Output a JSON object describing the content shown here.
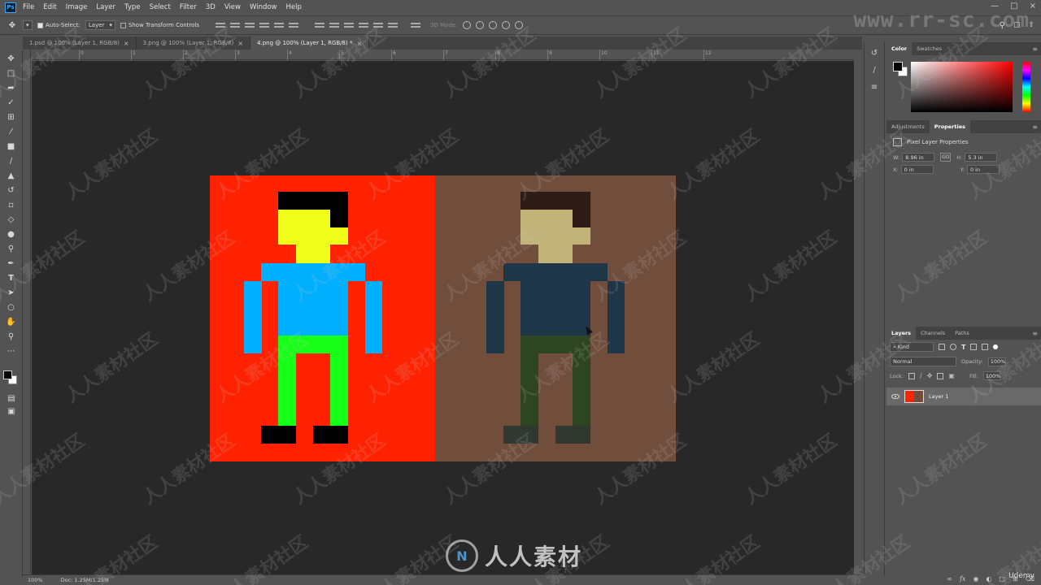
{
  "app": {
    "logo": "Ps"
  },
  "menu": [
    "File",
    "Edit",
    "Image",
    "Layer",
    "Type",
    "Select",
    "Filter",
    "3D",
    "View",
    "Window",
    "Help"
  ],
  "options": {
    "auto_select_label": "Auto-Select:",
    "auto_select_checked": true,
    "auto_select_target": "Layer",
    "show_transform_label": "Show Transform Controls",
    "mode_3d_label": "3D Mode:"
  },
  "tabs": [
    {
      "label": "1.psd @ 100% (Layer 1, RGB/8)",
      "close": "×"
    },
    {
      "label": "3.png @ 100% (Layer 1, RGB/8)",
      "close": "×"
    },
    {
      "label": "4.png @ 100% (Layer 1, RGB/8) *",
      "close": "×",
      "active": true
    }
  ],
  "ruler": {
    "labels": [
      "0",
      "1",
      "2",
      "3",
      "4",
      "5",
      "6",
      "7",
      "8",
      "9",
      "10",
      "11",
      "12"
    ]
  },
  "tools": [
    "move-tool",
    "marquee-tool",
    "lasso-tool",
    "quick-select-tool",
    "crop-tool",
    "eyedropper-tool",
    "healing-tool",
    "brush-tool",
    "stamp-tool",
    "history-brush-tool",
    "eraser-tool",
    "gradient-tool",
    "blur-tool",
    "dodge-tool",
    "pen-tool",
    "type-tool",
    "path-select-tool",
    "shape-tool",
    "hand-tool",
    "zoom-tool",
    "more-tools"
  ],
  "document": {
    "left_panel_color": "#ff2200",
    "right_panel_color": "#714d3c",
    "character_left": {
      "hair": "#000000",
      "skin": "#f0ff1a",
      "shirt": "#00b0ff",
      "pants": "#16ff16",
      "shoes": "#000000"
    },
    "character_right": {
      "hair": "#2e1c17",
      "skin": "#c2b378",
      "shirt": "#1f3548",
      "pants": "#2d4520",
      "shoes": "#303830"
    }
  },
  "status": {
    "zoom": "100%",
    "doc_info": "Doc: 1.25M/1.25M"
  },
  "color_panel": {
    "tabs": [
      "Color",
      "Swatches"
    ],
    "active_tab": "Color",
    "foreground": "#000000",
    "background": "#ffffff",
    "hue": "#ff0000"
  },
  "properties_panel": {
    "tabs": [
      "Adjustments",
      "Properties"
    ],
    "active_tab": "Properties",
    "title": "Pixel Layer Properties",
    "w_label": "W:",
    "w_value": "8.96 in",
    "link_label": "GO",
    "h_label": "H:",
    "h_value": "5.3 in",
    "x_label": "X:",
    "x_value": "0 in",
    "y_label": "Y:",
    "y_value": "0 in"
  },
  "layers_panel": {
    "tabs": [
      "Layers",
      "Channels",
      "Paths"
    ],
    "active_tab": "Layers",
    "kind_label": "⌕ Kind",
    "blend_mode": "Normal",
    "opacity_label": "Opacity:",
    "opacity_value": "100%",
    "lock_label": "Lock:",
    "fill_label": "Fill:",
    "fill_value": "100%",
    "layers": [
      {
        "name": "Layer 1",
        "visible": true
      }
    ]
  },
  "watermarks": {
    "url": "www.rr-sc.com",
    "center_logo": "N",
    "center_text": "人人素材",
    "tile_text": "人人素材社区",
    "udemy": "Udemy"
  }
}
